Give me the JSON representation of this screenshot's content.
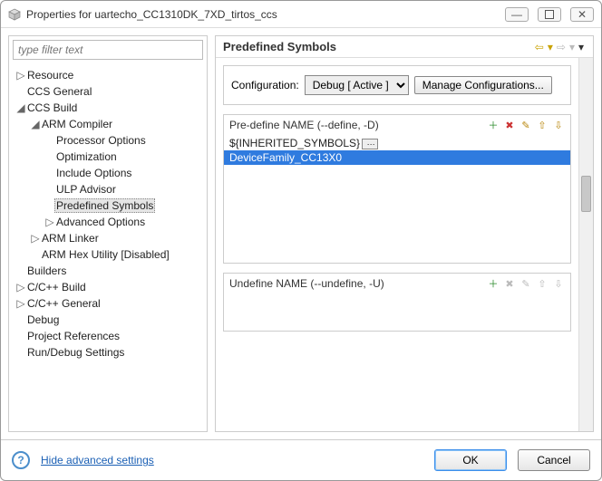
{
  "window": {
    "title": "Properties for uartecho_CC1310DK_7XD_tirtos_ccs"
  },
  "filter": {
    "placeholder": "type filter text"
  },
  "tree": {
    "resource": "Resource",
    "ccs_general": "CCS General",
    "ccs_build": "CCS Build",
    "arm_compiler": "ARM Compiler",
    "processor_options": "Processor Options",
    "optimization": "Optimization",
    "include_options": "Include Options",
    "ulp_advisor": "ULP Advisor",
    "predefined_symbols": "Predefined Symbols",
    "advanced_options": "Advanced Options",
    "arm_linker": "ARM Linker",
    "arm_hex_utility": "ARM Hex Utility  [Disabled]",
    "builders": "Builders",
    "c_cpp_build": "C/C++ Build",
    "c_cpp_general": "C/C++ General",
    "debug": "Debug",
    "project_references": "Project References",
    "run_debug_settings": "Run/Debug Settings"
  },
  "right": {
    "title": "Predefined Symbols",
    "config_label": "Configuration:",
    "config_value": "Debug  [ Active ]",
    "manage_btn": "Manage Configurations...",
    "define_label": "Pre-define NAME (--define, -D)",
    "define_items": [
      "${INHERITED_SYMBOLS}",
      "DeviceFamily_CC13X0"
    ],
    "undefine_label": "Undefine NAME (--undefine, -U)"
  },
  "footer": {
    "hide_link": "Hide advanced settings",
    "ok": "OK",
    "cancel": "Cancel"
  },
  "icons": {
    "add": "＋",
    "del": "✖",
    "edit": "✎",
    "up": "⇧",
    "down": "⇩",
    "back": "⇦",
    "fwd": "⇨",
    "menu": "▾",
    "min": "—",
    "close": "✕"
  }
}
